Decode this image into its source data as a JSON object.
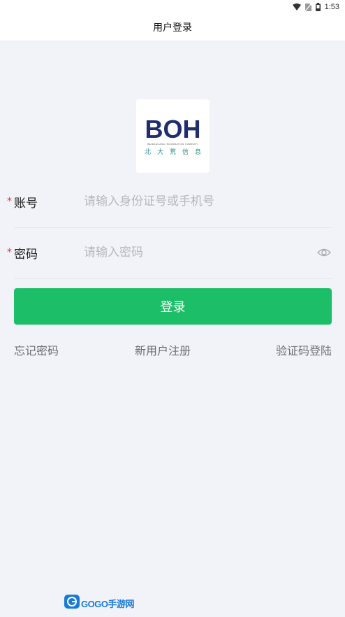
{
  "status_bar": {
    "time": "1:53",
    "icons": [
      "wifi-icon",
      "no-sim-icon",
      "battery-icon"
    ]
  },
  "header": {
    "title": "用户登录"
  },
  "logo": {
    "letters": "BOH",
    "subtitle": "BEIDAHUANG INFORMATION COMPANY",
    "chinese": "北大荒信息"
  },
  "form": {
    "account": {
      "required_mark": "*",
      "label": "账号",
      "placeholder": "请输入身份证号或手机号",
      "value": ""
    },
    "password": {
      "required_mark": "*",
      "label": "密码",
      "placeholder": "请输入密码",
      "value": ""
    }
  },
  "login_button": {
    "label": "登录"
  },
  "links": {
    "forgot": "忘记密码",
    "register": "新用户注册",
    "sms_login": "验证码登陆"
  },
  "watermark": {
    "text": "GOGO手游网"
  },
  "colors": {
    "primary": "#1cbf68",
    "required": "#e23b3b",
    "background": "#f1f3f8",
    "logo_navy": "#1f2e6e",
    "logo_teal": "#2a8a86"
  }
}
